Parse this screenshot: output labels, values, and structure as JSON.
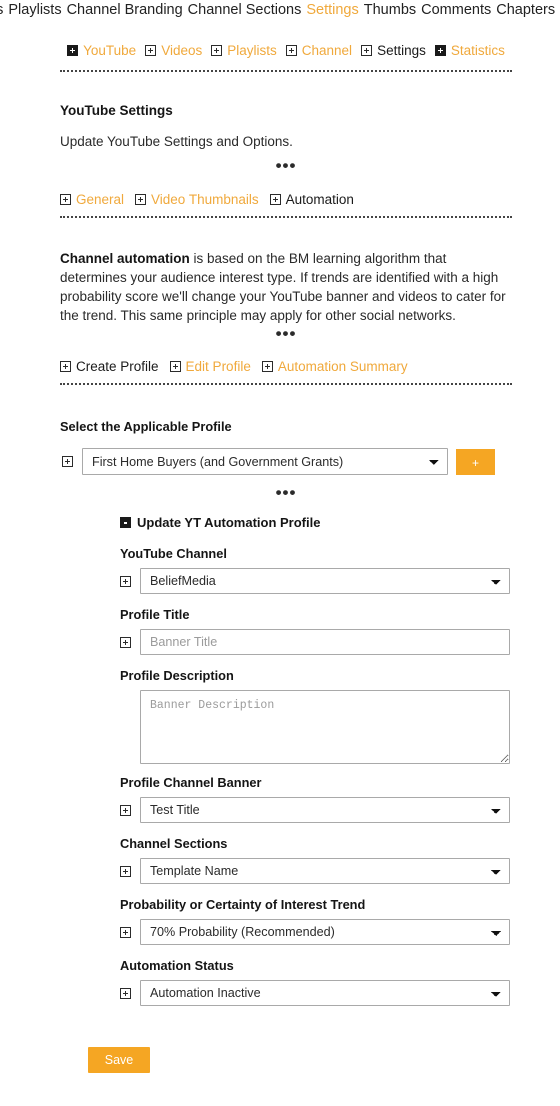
{
  "topnav": {
    "items": [
      {
        "label": "eos",
        "state": "default",
        "underline": true
      },
      {
        "label": "Playlists",
        "state": "default",
        "underline": true
      },
      {
        "label": "Channel Branding",
        "state": "default",
        "underline": true
      },
      {
        "label": "Channel Sections",
        "state": "default",
        "underline": true
      },
      {
        "label": "Settings",
        "state": "active",
        "underline": true
      },
      {
        "label": "Thumbs",
        "state": "default",
        "underline": true
      },
      {
        "label": "Comments",
        "state": "default",
        "underline": true
      },
      {
        "label": "Chapters",
        "state": "default",
        "underline": true
      }
    ],
    "trailing_icon": "chart-icon",
    "trailing_icon_glyph": "Ὄ8"
  },
  "tabs": [
    {
      "label": "YouTube",
      "icon": "plus-box-filled-icon",
      "color": "orange"
    },
    {
      "label": "Videos",
      "icon": "plus-box-icon",
      "color": "orange"
    },
    {
      "label": "Playlists",
      "icon": "plus-box-icon",
      "color": "orange"
    },
    {
      "label": "Channel",
      "icon": "plus-box-icon",
      "color": "orange"
    },
    {
      "label": "Settings",
      "icon": "plus-box-icon",
      "color": "dark"
    },
    {
      "label": "Statistics",
      "icon": "plus-box-filled-icon",
      "color": "orange"
    }
  ],
  "settings_section": {
    "title": "YouTube Settings",
    "body": "Update YouTube Settings and Options.",
    "divider": "•••",
    "links": [
      {
        "label": "General",
        "icon": "plus-box-icon",
        "color": "orange"
      },
      {
        "label": "Video Thumbnails",
        "icon": "plus-box-icon",
        "color": "orange"
      },
      {
        "label": "Automation",
        "icon": "plus-box-icon",
        "color": "dark"
      }
    ]
  },
  "automation_section": {
    "body_lead": "Channel automation",
    "body_rest": " is based on the BM learning algorithm that determines your audience interest type. If trends are identified with a high probability score we'll change your YouTube banner and videos to cater for the trend. This same principle may apply for other social networks.",
    "divider": "•••",
    "links": [
      {
        "label": "Create Profile",
        "icon": "plus-box-icon",
        "color": "dark"
      },
      {
        "label": "Edit Profile",
        "icon": "plus-box-icon",
        "color": "orange"
      },
      {
        "label": "Automation Summary",
        "icon": "plus-box-icon",
        "color": "orange"
      }
    ]
  },
  "profile_select": {
    "label": "Select the Applicable Profile",
    "value": "First Home Buyers (and Government Grants)",
    "options": [
      "First Home Buyers (and Government Grants)"
    ],
    "add_button_label": "+",
    "divider": "•••"
  },
  "form": {
    "heading": "Update YT Automation Profile",
    "fields": [
      {
        "label": "YouTube Channel",
        "type": "select",
        "value": "BeliefMedia",
        "options": [
          "BeliefMedia"
        ]
      },
      {
        "label": "Profile Title",
        "type": "text",
        "value": "",
        "placeholder": "Banner Title"
      },
      {
        "label": "Profile Description",
        "type": "textarea",
        "value": "",
        "placeholder": "Banner Description"
      },
      {
        "label": "Profile Channel Banner",
        "type": "select",
        "value": "Test Title",
        "options": [
          "Test Title"
        ]
      },
      {
        "label": "Channel Sections",
        "type": "select",
        "value": "Template Name",
        "options": [
          "Template Name"
        ]
      },
      {
        "label": "Probability or Certainty of Interest Trend",
        "type": "select",
        "value": "70% Probability (Recommended)",
        "options": [
          "70% Probability (Recommended)"
        ]
      },
      {
        "label": "Automation Status",
        "type": "select",
        "value": "Automation Inactive",
        "options": [
          "Automation Inactive"
        ]
      }
    ],
    "save_label": "Save"
  },
  "colors": {
    "accent": "#f5a623",
    "link_orange": "#f0a93c",
    "text": "#1a1a1a",
    "border": "#a9a9a9"
  }
}
